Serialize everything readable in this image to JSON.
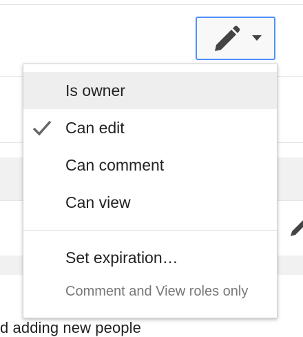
{
  "permission_button": {
    "icon": "pencil-icon",
    "caret_icon": "caret-down-icon",
    "border_color": "#4d90fe"
  },
  "menu": {
    "items": [
      {
        "label": "Is owner",
        "checked": false,
        "highlighted": true
      },
      {
        "label": "Can edit",
        "checked": true,
        "highlighted": false
      },
      {
        "label": "Can comment",
        "checked": false,
        "highlighted": false
      },
      {
        "label": "Can view",
        "checked": false,
        "highlighted": false
      }
    ],
    "set_expiration_label": "Set expiration…",
    "expiration_note": "Comment and View roles only"
  },
  "background": {
    "footer_text": "d adding new people"
  }
}
